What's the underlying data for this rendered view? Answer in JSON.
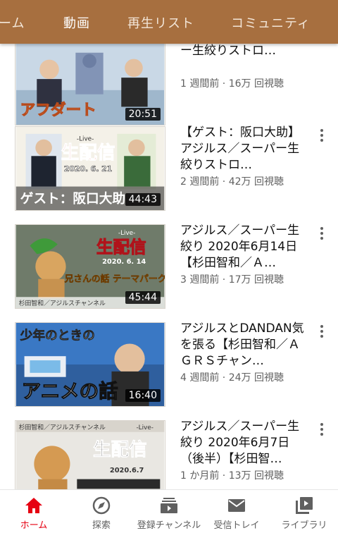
{
  "tabs": [
    "ーム",
    "動画",
    "再生リスト",
    "コミュニティ"
  ],
  "videos": [
    {
      "title": "助】アジルス／スーパー生絞りストロ…",
      "meta": "1 週間前 · 16万 回視聴",
      "duration": "20:51",
      "thumb_text": "アフダート"
    },
    {
      "title": "【ゲスト：阪口大助】アジルス／スーパー生絞りストロ…",
      "meta": "2 週間前 · 42万 回視聴",
      "duration": "44:43",
      "thumb_text": "生配信",
      "thumb_sub": "2020. 6. 21",
      "thumb_caption": "ゲスト：阪口大助",
      "thumb_tag": "-Live-"
    },
    {
      "title": "アジルス／スーパー生絞り 2020年6月14日【杉田智和／Ａ…",
      "meta": "3 週間前 · 17万 回視聴",
      "duration": "45:44",
      "thumb_text": "生配信",
      "thumb_sub": "2020. 6. 14",
      "thumb_caption": "兄さんの話 テーマパークの…",
      "thumb_tag": "-Live-",
      "thumb_footer": "杉田智和／アジルスチャンネル"
    },
    {
      "title": "アジルスとDANDAN気を張る【杉田智和／ＡＧＲＳチャン…",
      "meta": "4 週間前 · 24万 回視聴",
      "duration": "16:40",
      "thumb_text": "少年のときの",
      "thumb_caption": "アニメの話"
    },
    {
      "title": "アジルス／スーパー生絞り 2020年6月7日（後半）【杉田智…",
      "meta": "1 か月前 · 13万 回視聴",
      "duration": "",
      "thumb_text": "生配信",
      "thumb_sub": "2020.6.7",
      "thumb_tag": "-Live-",
      "thumb_footer": "杉田智和／アジルスチャンネル"
    }
  ],
  "nav": [
    {
      "label": "ホーム",
      "icon": "home-icon"
    },
    {
      "label": "探索",
      "icon": "compass-icon"
    },
    {
      "label": "登録チャンネル",
      "icon": "subscriptions-icon"
    },
    {
      "label": "受信トレイ",
      "icon": "inbox-icon"
    },
    {
      "label": "ライブラリ",
      "icon": "library-icon"
    }
  ],
  "colors": {
    "header": "#a76f3f",
    "accent": "#e60012"
  }
}
